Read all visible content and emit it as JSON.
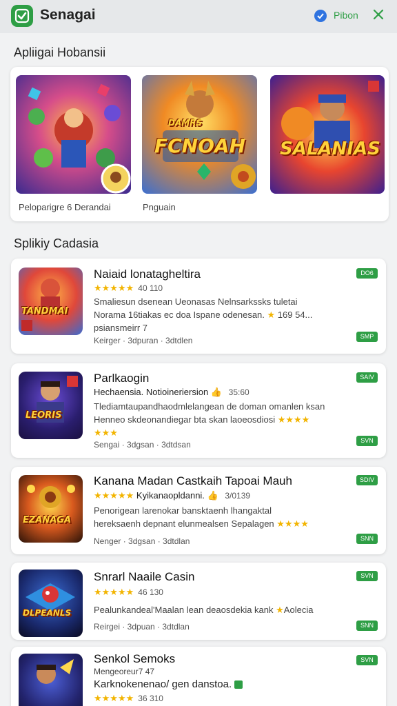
{
  "header": {
    "title": "Senagai",
    "action_label": "Pibon"
  },
  "featured": {
    "section_title": "Apliigai Hobansii",
    "items": [
      {
        "logo_text": "FCNOAH",
        "logo_top": "DAMRS",
        "caption": "Peloparigre 6 Derandai"
      },
      {
        "logo_text": "",
        "logo_top": "",
        "caption": "Pnguain"
      },
      {
        "logo_text": "SALANIAS",
        "logo_top": "",
        "caption": ""
      }
    ]
  },
  "list": {
    "section_title": "Splikiy Cadasia",
    "apps": [
      {
        "title": "Naiaid lonatagheltira",
        "rating": "40 110",
        "desc1": "Smaliesun dsenean Ueonasas Nelnsarkssks tuletai",
        "desc2": "Norama 16tiakas ec doa Ispane odenesan.",
        "desc2_tail": "169 54...",
        "desc3": "psiansmeirr 7",
        "meta": "Keirger · 3dpuran · 3dtdlen",
        "badge_top": "DO6",
        "badge_bottom": "SMP",
        "thumb_text": "TANDMAI"
      },
      {
        "title": "Parlkaogin",
        "subtitle": "Hechaensia. Notioineriersion",
        "sub_count": "35:60",
        "desc1": "Tlediamtaupandhaodmlelangean de doman omanlen ksan",
        "desc2": "Henneo skdeonandiegar bta skan laoeosdiosi",
        "meta": "Sengai · 3dgsan · 3dtdsan",
        "badge_top": "SAIV",
        "badge_bottom": "SVN",
        "thumb_text": "LEORIS"
      },
      {
        "title": "Kanana Madan Castkaih Tapoai Mauh",
        "subtitle": "Kyikanaopldanni.",
        "rating": "3/0139",
        "desc1": "Penorigean larenokar bansktaenh lhangaktal",
        "desc2": "hereksaenh depnant elunmealsen Sepalagen",
        "meta": "Nenger · 3dgsan · 3dtdlan",
        "badge_top": "SDIV",
        "badge_bottom": "SNN",
        "thumb_text": "EZANAGA"
      },
      {
        "title": "Snrarl Naaile Casin",
        "rating": "46 130",
        "desc1": "Pealunkandeal'Maalan lean deaosdekia kank",
        "desc1_tail": "Aolecia",
        "meta": "Reirgei · 3dpuan · 3dtdlan",
        "badge_top": "SVN",
        "badge_bottom": "SNN",
        "thumb_text": "DLPEANLS"
      },
      {
        "title": "Senkol Semoks",
        "subtitle": "Mengeoreur7 47",
        "desc1": "Karknokenenao/ gen danstoa.",
        "rating": "36 310",
        "badge_top": "SVN",
        "thumb_text": ""
      }
    ]
  },
  "colors": {
    "accent": "#2e9e45",
    "star": "#f2b400",
    "verify": "#2f73e0"
  }
}
